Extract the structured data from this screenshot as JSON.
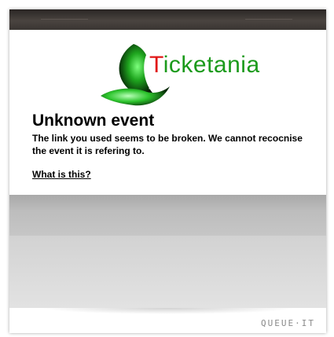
{
  "logo": {
    "name_lead": "T",
    "name_rest": "icketania",
    "lead_color": "#e01616",
    "rest_color": "#1b9a1b",
    "mark_icon": "green-butterfly-wing-icon"
  },
  "error": {
    "title": "Unknown event",
    "message": "The link you used seems to be broken. We cannot recocnise the event it is refering to.",
    "help_link": "What is this?"
  },
  "footer": {
    "brand": "QUEUE·IT"
  },
  "colors": {
    "top_bar": "#3a3532",
    "band_dark": "#bdbdbd",
    "band_light": "#dcdcdc"
  }
}
